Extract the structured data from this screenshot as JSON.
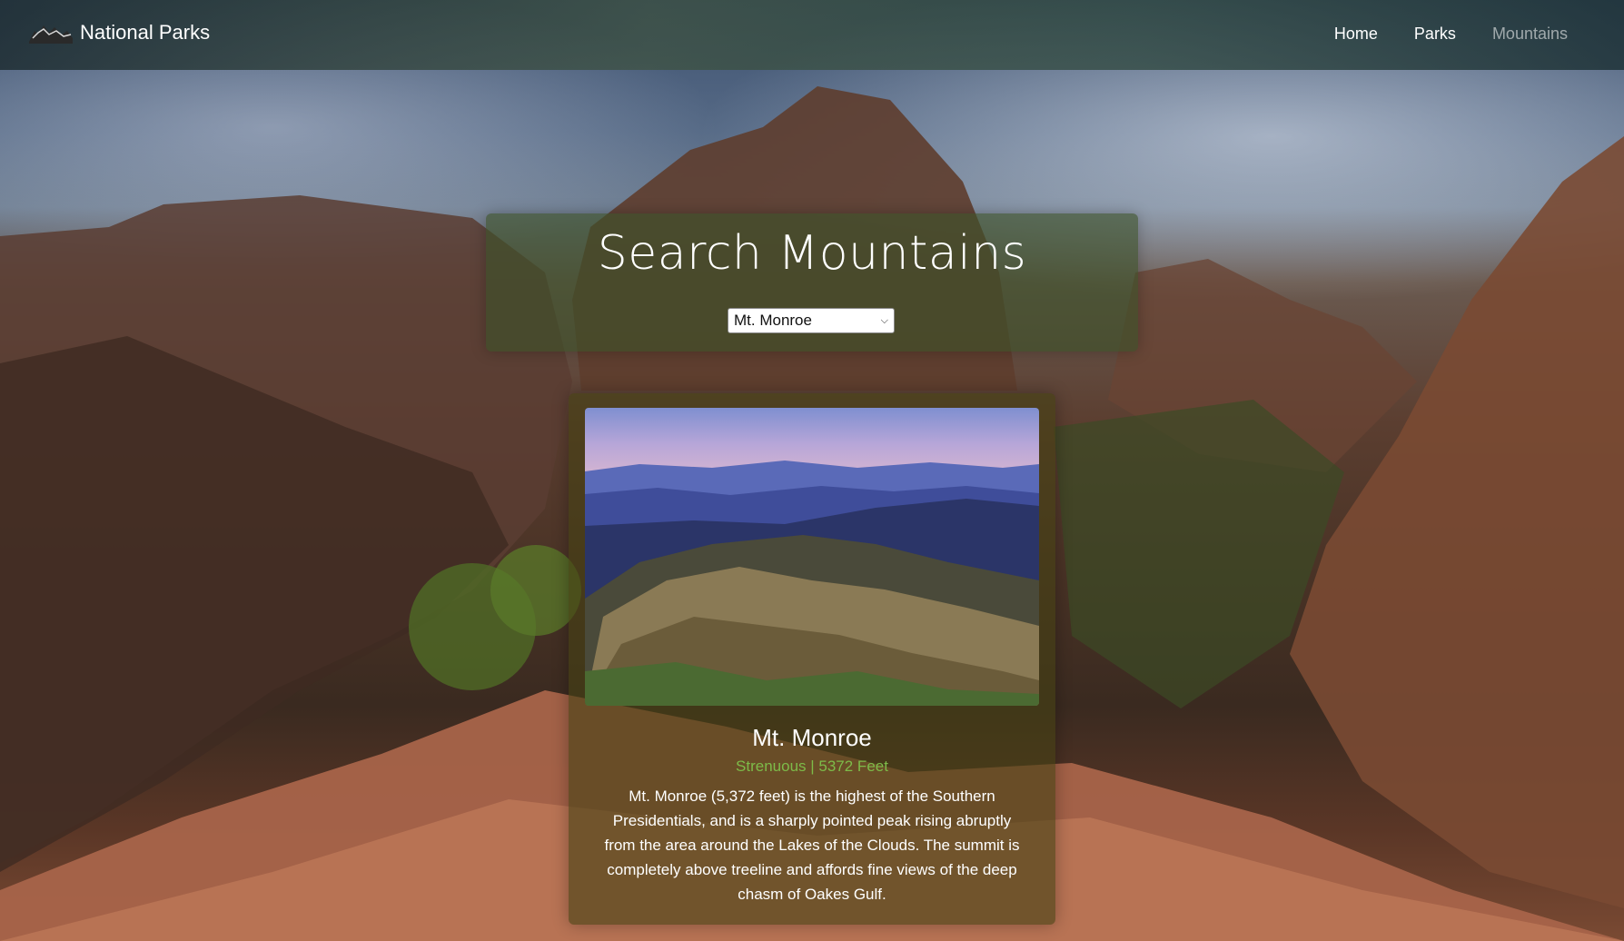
{
  "navbar": {
    "brand": "National Parks",
    "links": [
      {
        "label": "Home"
      },
      {
        "label": "Parks"
      },
      {
        "label": "Mountains"
      }
    ]
  },
  "search": {
    "title": "Search Mountains",
    "selected": "Mt. Monroe"
  },
  "card": {
    "name": "Mt. Monroe",
    "subtitle": "Strenuous | 5372 Feet",
    "description": "Mt. Monroe (5,372 feet) is the highest of the Southern Presidentials, and is a sharply pointed peak rising abruptly from the area around the Lakes of the Clouds. The summit is completely above treeline and affords fine views of the deep chasm of Oakes Gulf."
  },
  "colors": {
    "accent_green": "#7dbb49",
    "active_link": "rgba(255,255,255,0.55)"
  }
}
